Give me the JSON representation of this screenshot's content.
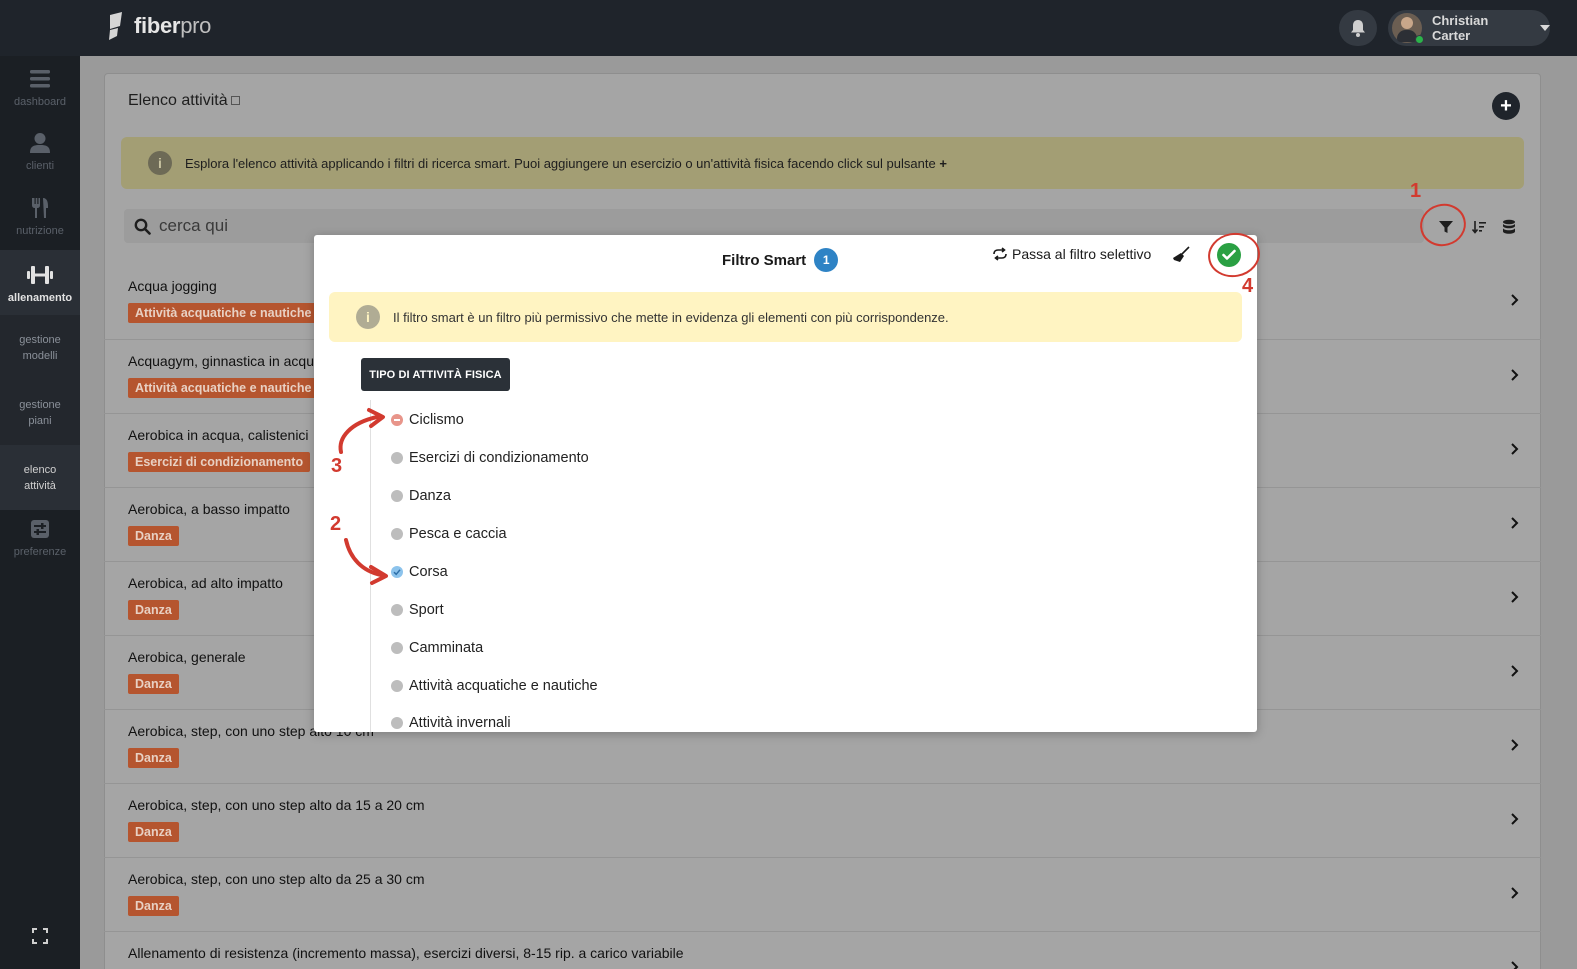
{
  "app": {
    "logo": {
      "part1": "fiber",
      "part2": "pro"
    },
    "user": {
      "name": "Christian Carter"
    }
  },
  "sidebar": {
    "items": [
      {
        "label": "dashboard",
        "icon": "menu-icon"
      },
      {
        "label": "clienti",
        "icon": "user-icon"
      },
      {
        "label": "nutrizione",
        "icon": "fork-knife-icon"
      },
      {
        "label": "allenamento",
        "icon": "dumbbell-icon",
        "active": true
      },
      {
        "label": "gestione modelli",
        "icon": ""
      },
      {
        "label": "gestione piani",
        "icon": ""
      },
      {
        "label": "elenco attività",
        "icon": ""
      },
      {
        "label": "preferenze",
        "icon": "sliders-icon"
      }
    ]
  },
  "page": {
    "title": "Elenco attività",
    "info": "Esplora l'elenco attività applicando i filtri di ricerca smart. Puoi aggiungere un esercizio o un'attività fisica facendo click sul pulsante",
    "info_plus": "+",
    "search_placeholder": "cerca qui"
  },
  "activities": [
    {
      "name": "Acqua jogging",
      "tag": "Attività acquatiche e nautiche"
    },
    {
      "name": "Acquagym, ginnastica in acqu",
      "tag": "Attività acquatiche e nautiche"
    },
    {
      "name": "Aerobica in acqua, calistenici",
      "tag": "Esercizi di condizionamento"
    },
    {
      "name": "Aerobica, a basso impatto",
      "tag": "Danza"
    },
    {
      "name": "Aerobica, ad alto impatto",
      "tag": "Danza"
    },
    {
      "name": "Aerobica, generale",
      "tag": "Danza"
    },
    {
      "name": "Aerobica, step, con uno step alto 10 cm",
      "tag": "Danza"
    },
    {
      "name": "Aerobica, step, con uno step alto da 15 a 20 cm",
      "tag": "Danza"
    },
    {
      "name": "Aerobica, step, con uno step alto da 25 a 30 cm",
      "tag": "Danza"
    },
    {
      "name": "Allenamento di resistenza (incremento massa), esercizi diversi, 8-15 rip. a carico variabile",
      "tag": ""
    }
  ],
  "modal": {
    "title": "Filtro Smart",
    "count": "1",
    "switch_label": "Passa al filtro selettivo",
    "info": "Il filtro smart è un filtro più permissivo che mette in evidenza gli elementi con più corrispondenze.",
    "section": "TIPO DI ATTIVITÀ FISICA",
    "options": [
      {
        "label": "Ciclismo",
        "state": "excluded"
      },
      {
        "label": "Esercizi di condizionamento",
        "state": "none"
      },
      {
        "label": "Danza",
        "state": "none"
      },
      {
        "label": "Pesca e caccia",
        "state": "none"
      },
      {
        "label": "Corsa",
        "state": "included"
      },
      {
        "label": "Sport",
        "state": "none"
      },
      {
        "label": "Camminata",
        "state": "none"
      },
      {
        "label": "Attività acquatiche e nautiche",
        "state": "none"
      },
      {
        "label": "Attività invernali",
        "state": "none"
      }
    ]
  },
  "annotations": {
    "n1": "1",
    "n2": "2",
    "n3": "3",
    "n4": "4"
  },
  "colors": {
    "tag": "#b5552f",
    "badge": "#2e83c5",
    "confirm": "#2aa043",
    "annotation": "#d23a2f"
  }
}
